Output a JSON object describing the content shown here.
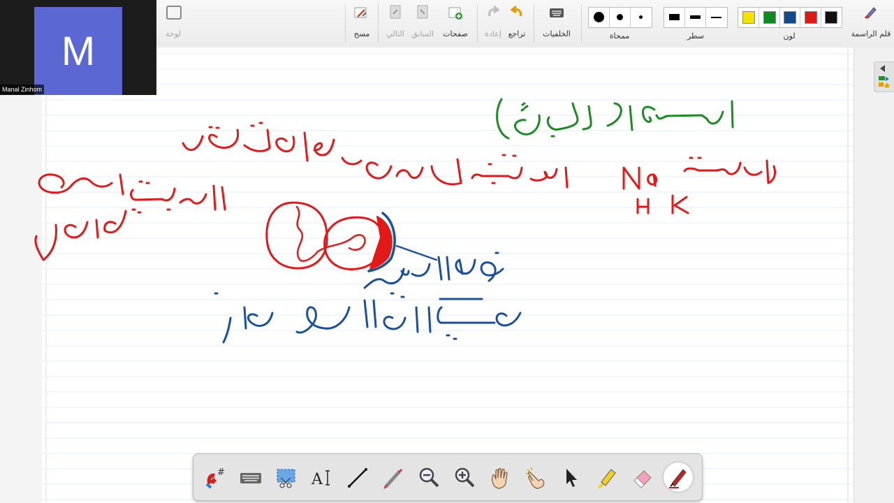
{
  "toolbar": {
    "pen_label": "قلم الراسمة",
    "color_label": "لون",
    "line_label": "سطر",
    "eraser_label": "ممحاة",
    "backgrounds_label": "الخلفيات",
    "undo_label": "تراجع",
    "redo_label": "إعادة",
    "pages_label": "صفحات",
    "prev_label": "السابق",
    "next_label": "التالي",
    "clear_label": "مسح",
    "board_label": "لوحة",
    "colors": [
      "#f4e100",
      "#0f8a1e",
      "#0e4c8c",
      "#e01818",
      "#111111"
    ]
  },
  "webcam": {
    "initial": "M",
    "name": "Manal Zinhom"
  },
  "handwriting": {
    "green_title": "المستوى الجزيئي",
    "red_line_1": "أيونات بتتحرك عبر الأغشية",
    "red_ions": "أيونات",
    "red_left_1": "الأيونات تسحب",
    "red_left_2": "تحمل الماء",
    "symbols": [
      "Na",
      "H",
      "K"
    ],
    "blue_1": "ضغط الامتلاء",
    "blue_2": "ضغط الماء على الجدار"
  }
}
